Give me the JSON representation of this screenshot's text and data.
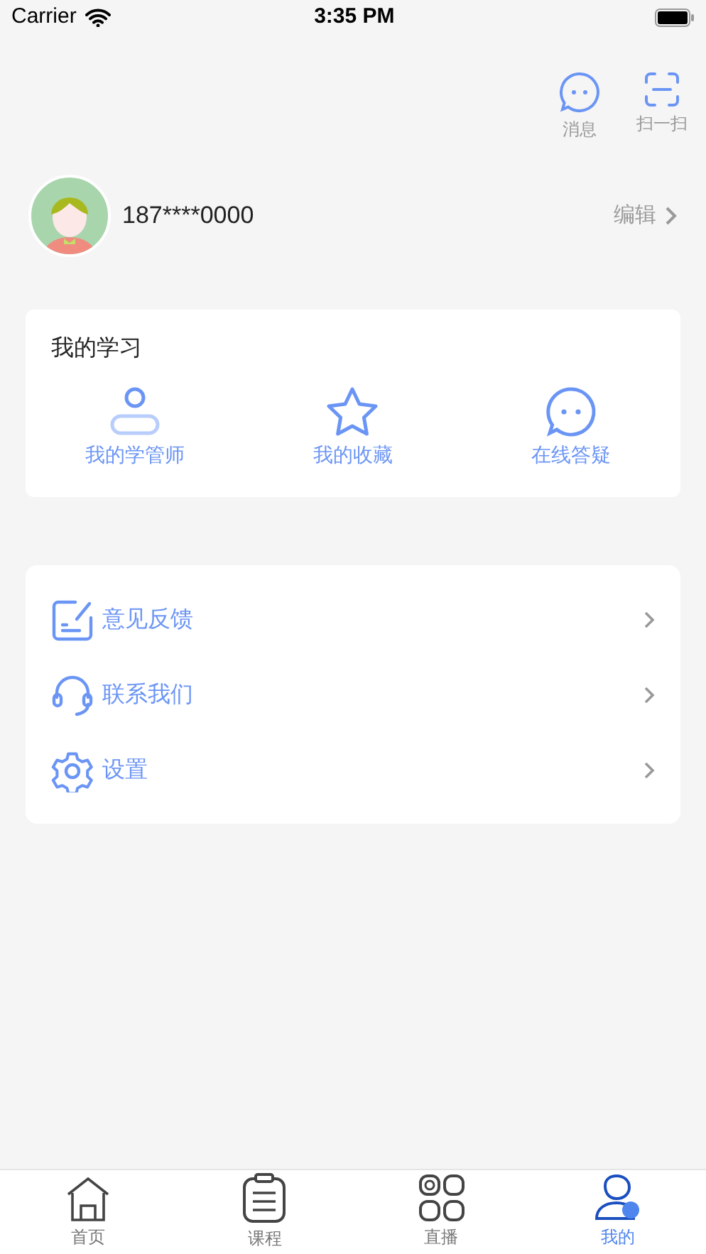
{
  "status_bar": {
    "carrier": "Carrier",
    "time": "3:35 PM"
  },
  "header_actions": [
    {
      "kind": "message",
      "label": "消息"
    },
    {
      "kind": "scan",
      "label": "扫一扫"
    }
  ],
  "profile": {
    "phone": "187****0000",
    "edit_label": "编辑"
  },
  "my_study": {
    "title": "我的学习",
    "items": [
      {
        "kind": "tutor",
        "label": "我的学管师"
      },
      {
        "kind": "favorite",
        "label": "我的收藏"
      },
      {
        "kind": "qa",
        "label": "在线答疑"
      }
    ]
  },
  "menu": [
    {
      "kind": "feedback",
      "label": "意见反馈"
    },
    {
      "kind": "contact",
      "label": "联系我们"
    },
    {
      "kind": "settings",
      "label": "设置"
    }
  ],
  "tab_bar": [
    {
      "kind": "home",
      "label": "首页",
      "selected": false
    },
    {
      "kind": "course",
      "label": "课程",
      "selected": false
    },
    {
      "kind": "live",
      "label": "直播",
      "selected": false
    },
    {
      "kind": "mine",
      "label": "我的",
      "selected": true
    }
  ]
}
